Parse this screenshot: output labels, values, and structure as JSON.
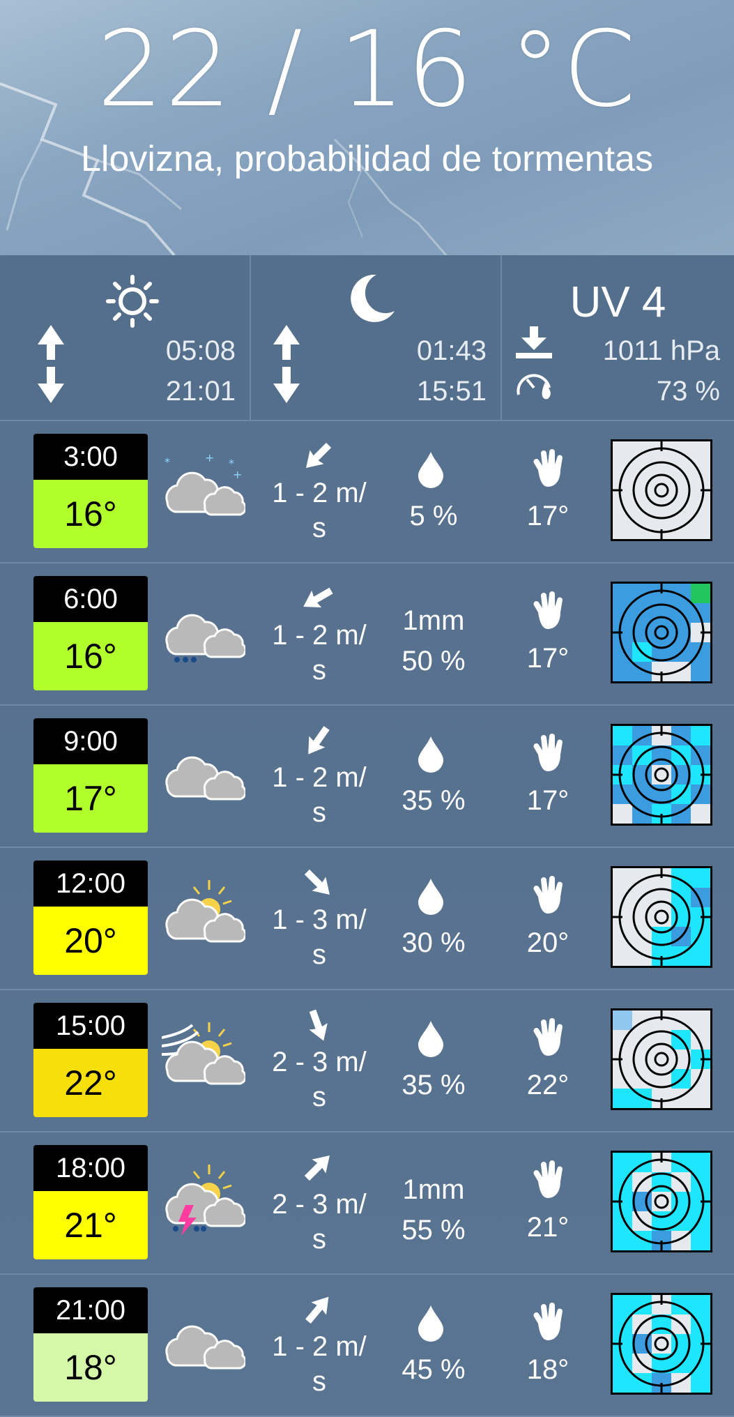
{
  "header": {
    "temperature": "22 / 16 °C",
    "condition": "Llovizna, probabilidad de tormentas"
  },
  "sun": {
    "icon": "sun-icon",
    "rise": "05:08",
    "set": "21:01"
  },
  "moon": {
    "icon": "moon-icon",
    "rise": "01:43",
    "set": "15:51"
  },
  "extra": {
    "uv": "UV 4",
    "pressure": "1011 hPa",
    "humidity": "73 %"
  },
  "colors": {
    "green": "#b2ff2e",
    "yellow": "#ffff00",
    "gold": "#f7df0c",
    "pale_green": "#d4f7a8"
  },
  "hours": [
    {
      "time": "3:00",
      "temp": "16°",
      "color": "#b2ff2e",
      "icon": "cloudy-snow-icon",
      "wind_dir": 225,
      "wind": "1 - 2 m/",
      "wind2": "s",
      "rain_mm": "",
      "rain_pct": "5 %",
      "feels": "17°",
      "radar": "empty"
    },
    {
      "time": "6:00",
      "temp": "16°",
      "color": "#b2ff2e",
      "icon": "cloudy-drizzle-icon",
      "wind_dir": 240,
      "wind": "1 - 2 m/",
      "wind2": "s",
      "rain_mm": "1mm",
      "rain_pct": "50 %",
      "feels": "17°",
      "radar": "blue-heavy"
    },
    {
      "time": "9:00",
      "temp": "17°",
      "color": "#b2ff2e",
      "icon": "cloudy-icon",
      "wind_dir": 215,
      "wind": "1 - 2 m/",
      "wind2": "s",
      "rain_mm": "",
      "rain_pct": "35 %",
      "feels": "17°",
      "radar": "blue-mixed"
    },
    {
      "time": "12:00",
      "temp": "20°",
      "color": "#ffff00",
      "icon": "partly-cloudy-icon",
      "wind_dir": 135,
      "wind": "1 - 3 m/",
      "wind2": "s",
      "rain_mm": "",
      "rain_pct": "30 %",
      "feels": "20°",
      "radar": "cyan-right"
    },
    {
      "time": "15:00",
      "temp": "22°",
      "color": "#f7df0c",
      "icon": "windy-partly-cloudy-icon",
      "wind_dir": 160,
      "wind": "2 - 3 m/",
      "wind2": "s",
      "rain_mm": "",
      "rain_pct": "35 %",
      "feels": "22°",
      "radar": "cyan-light"
    },
    {
      "time": "18:00",
      "temp": "21°",
      "color": "#ffff00",
      "icon": "thunderstorm-sun-icon",
      "wind_dir": 45,
      "wind": "2 - 3 m/",
      "wind2": "s",
      "rain_mm": "1mm",
      "rain_pct": "55 %",
      "feels": "21°",
      "radar": "cyan-heavy"
    },
    {
      "time": "21:00",
      "temp": "18°",
      "color": "#d4f7a8",
      "icon": "cloudy-icon",
      "wind_dir": 40,
      "wind": "1 - 2 m/",
      "wind2": "s",
      "rain_mm": "",
      "rain_pct": "45 %",
      "feels": "18°",
      "radar": "cyan-heavy"
    }
  ]
}
